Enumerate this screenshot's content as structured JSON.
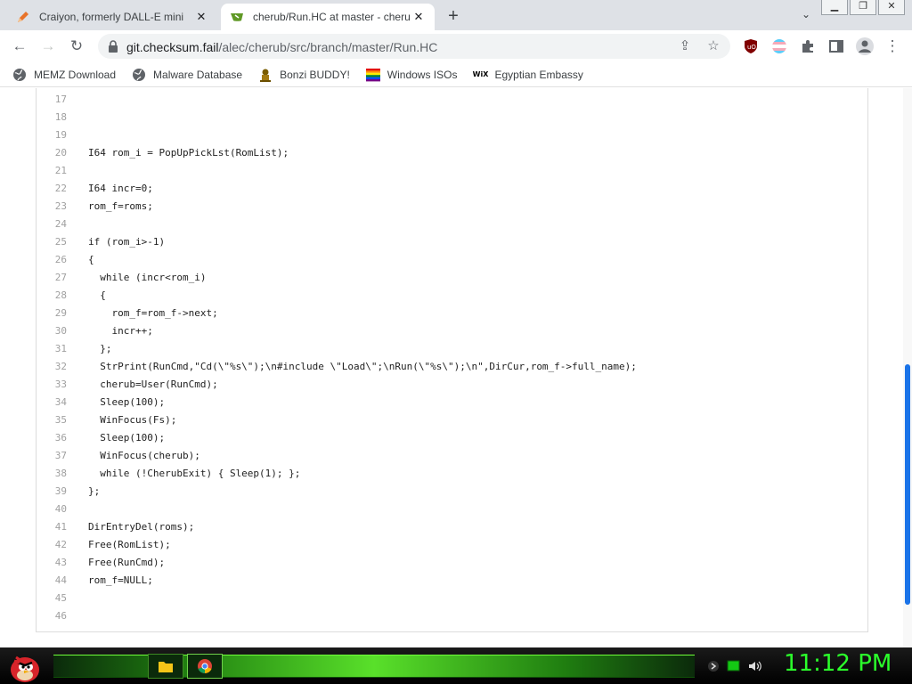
{
  "tabs": [
    {
      "title": "Craiyon, formerly DALL-E mini",
      "favicon": "pencil-icon",
      "active": false
    },
    {
      "title": "cherub/Run.HC at master - cheru",
      "favicon": "gitea-icon",
      "active": true
    }
  ],
  "window_controls": [
    "▁",
    "❐",
    "✕"
  ],
  "address": {
    "domain": "git.checksum.fail",
    "path": "/alec/cherub/src/branch/master/Run.HC"
  },
  "bookmarks": [
    {
      "label": "MEMZ Download",
      "icon": "globe-icon"
    },
    {
      "label": "Malware Database",
      "icon": "globe-icon"
    },
    {
      "label": "Bonzi BUDDY!",
      "icon": "bonzi-icon"
    },
    {
      "label": "Windows ISOs",
      "icon": "windows-flag-icon"
    },
    {
      "label": "Egyptian Embassy",
      "icon": "wix-icon"
    }
  ],
  "code": {
    "lines": [
      {
        "num": "",
        "text": "};"
      },
      {
        "num": "17",
        "text": ""
      },
      {
        "num": "18",
        "text": ""
      },
      {
        "num": "19",
        "text": ""
      },
      {
        "num": "20",
        "text": "I64 rom_i = PopUpPickLst(RomList);"
      },
      {
        "num": "21",
        "text": ""
      },
      {
        "num": "22",
        "text": "I64 incr=0;"
      },
      {
        "num": "23",
        "text": "rom_f=roms;"
      },
      {
        "num": "24",
        "text": ""
      },
      {
        "num": "25",
        "text": "if (rom_i>-1)"
      },
      {
        "num": "26",
        "text": "{"
      },
      {
        "num": "27",
        "text": "  while (incr<rom_i)"
      },
      {
        "num": "28",
        "text": "  {"
      },
      {
        "num": "29",
        "text": "    rom_f=rom_f->next;"
      },
      {
        "num": "30",
        "text": "    incr++;"
      },
      {
        "num": "31",
        "text": "  };"
      },
      {
        "num": "32",
        "text": "  StrPrint(RunCmd,\"Cd(\\\"%s\\\");\\n#include \\\"Load\\\";\\nRun(\\\"%s\\\");\\n\",DirCur,rom_f->full_name);"
      },
      {
        "num": "33",
        "text": "  cherub=User(RunCmd);"
      },
      {
        "num": "34",
        "text": "  Sleep(100);"
      },
      {
        "num": "35",
        "text": "  WinFocus(Fs);"
      },
      {
        "num": "36",
        "text": "  Sleep(100);"
      },
      {
        "num": "37",
        "text": "  WinFocus(cherub);"
      },
      {
        "num": "38",
        "text": "  while (!CherubExit) { Sleep(1); };"
      },
      {
        "num": "39",
        "text": "};"
      },
      {
        "num": "40",
        "text": ""
      },
      {
        "num": "41",
        "text": "DirEntryDel(roms);"
      },
      {
        "num": "42",
        "text": "Free(RomList);"
      },
      {
        "num": "43",
        "text": "Free(RunCmd);"
      },
      {
        "num": "44",
        "text": "rom_f=NULL;"
      },
      {
        "num": "45",
        "text": ""
      },
      {
        "num": "46",
        "text": ""
      }
    ]
  },
  "taskbar": {
    "clock": "11:12 PM",
    "pinned": [
      "folder-icon",
      "chrome-icon"
    ],
    "tray": [
      "network-icon",
      "battery-icon",
      "volume-icon"
    ]
  },
  "colors": {
    "accent_blue": "#1a73e8",
    "clock_green": "#2bff2b",
    "taskbar_green": "#59e02a"
  }
}
